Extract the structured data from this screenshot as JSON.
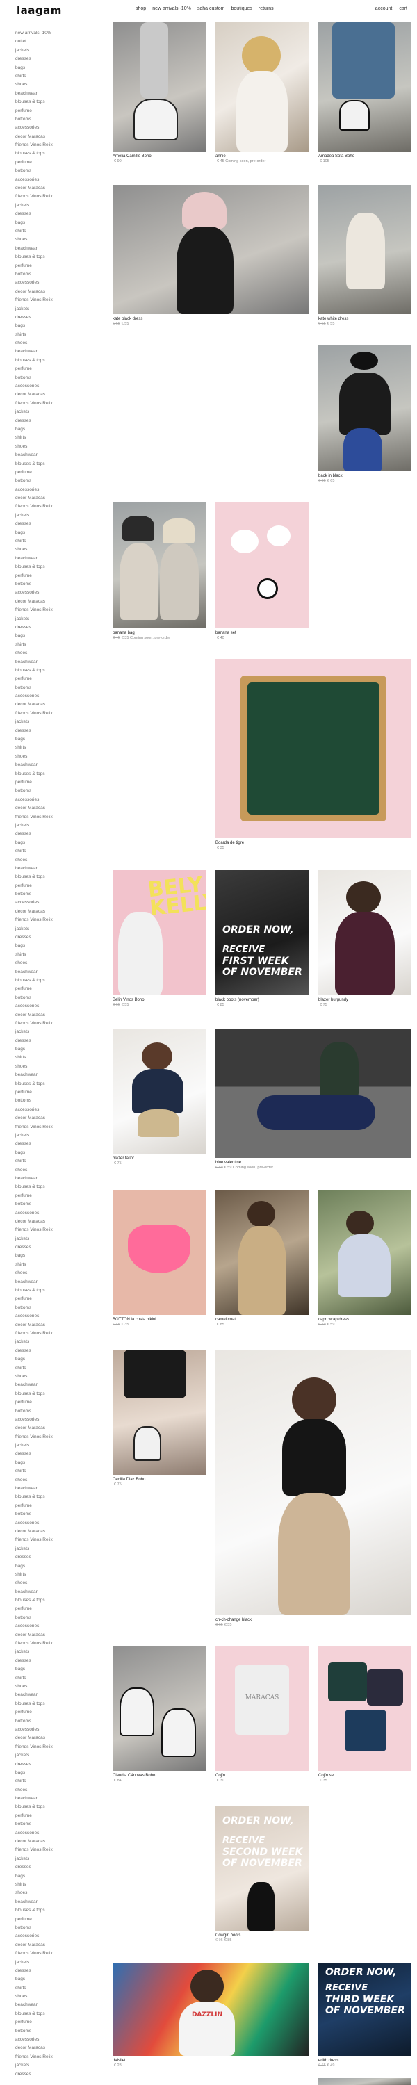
{
  "brand": {
    "logo": "laagam"
  },
  "nav": {
    "items": [
      "shop",
      "new arrivals -10%",
      "saha custom",
      "boutiques",
      "returns"
    ]
  },
  "utils": {
    "account": "account",
    "cart": "cart"
  },
  "sidebar": {
    "first_group": [
      "new arrivals -10%",
      "outlet",
      "jackets",
      "dresses",
      "bags",
      "shirts",
      "shoes",
      "beachwear",
      "blouses & tops",
      "perfume",
      "bottoms",
      "accessories",
      "decor Maracas",
      "friends Vinos Relix"
    ],
    "repeat_group": [
      "blouses & tops",
      "perfume",
      "bottoms",
      "accessories",
      "decor Maracas",
      "friends Vinos Relix",
      "jackets",
      "dresses",
      "bags",
      "shirts",
      "shoes",
      "beachwear"
    ]
  },
  "products": [
    {
      "name": "Amelia Camille Boho",
      "price": "€ 90",
      "old": ""
    },
    {
      "name": "annie",
      "price": "€ 45 Coming soon, pre-order",
      "old": ""
    },
    {
      "name": "Amadea Sofa Boho",
      "price": "€ 105",
      "old": ""
    },
    {
      "name": "kate black dress",
      "price": "€ 55",
      "old": "€ 65"
    },
    {
      "name": "kate white dress",
      "price": "€ 55",
      "old": "€ 65"
    },
    {
      "name": "back in black",
      "price": "€ 65",
      "old": "€ 95"
    },
    {
      "name": "banana bag",
      "price": "€ 35 Coming soon, pre-order",
      "old": "€ 45"
    },
    {
      "name": "banana set",
      "price": "€ 40",
      "old": ""
    },
    {
      "name": "Boarda de tigre",
      "price": "€ 35",
      "old": ""
    },
    {
      "name": "Belin Vinos Boho",
      "price": "€ 55",
      "old": "€ 65"
    },
    {
      "name": "black boots (november)",
      "price": "€ 85",
      "old": ""
    },
    {
      "name": "blazer burgundy",
      "price": "€ 75",
      "old": ""
    },
    {
      "name": "blazer tailor",
      "price": "€ 75",
      "old": ""
    },
    {
      "name": "blue valentine",
      "price": "€ 59 Coming soon, pre-order",
      "old": "€ 69"
    },
    {
      "name": "BOTTON la costa bikini",
      "price": "€ 35",
      "old": "€ 45"
    },
    {
      "name": "camel coat",
      "price": "€ 85",
      "old": ""
    },
    {
      "name": "capri wrap dress",
      "price": "€ 59",
      "old": "€ 79"
    },
    {
      "name": "Cecilia Diaz Boho",
      "price": "€ 75",
      "old": ""
    },
    {
      "name": "ch-ch-change black",
      "price": "€ 55",
      "old": "€ 65"
    },
    {
      "name": "Claudia Cánovas Boho",
      "price": "€ 84",
      "old": ""
    },
    {
      "name": "Cojín",
      "price": "€ 30",
      "old": ""
    },
    {
      "name": "Cojín set",
      "price": "€ 35",
      "old": ""
    },
    {
      "name": "Cowgirl boots",
      "price": "€ 85",
      "old": "€ 95"
    },
    {
      "name": "daisilet",
      "price": "€ 28",
      "old": ""
    },
    {
      "name": "edith dress",
      "price": "€ 49",
      "old": "€ 65"
    }
  ],
  "promos": {
    "first": {
      "line1": "ORDER NOW,",
      "line2": "RECEIVE",
      "line3": "FIRST WEEK",
      "line4": "OF NOVEMBER"
    },
    "second": {
      "line1": "ORDER NOW,",
      "line2": "RECEIVE",
      "line3": "SECOND WEEK",
      "line4": "OF NOVEMBER"
    },
    "third": {
      "line1": "ORDER NOW,",
      "line2": "RECEIVE",
      "line3": "THIRD WEEK",
      "line4": "OF NOVEMBER"
    }
  },
  "graphics": {
    "mural_text": "BELY KELLY",
    "pillow_text": "MARACAS",
    "shirt_text": "DAZZLIN"
  }
}
